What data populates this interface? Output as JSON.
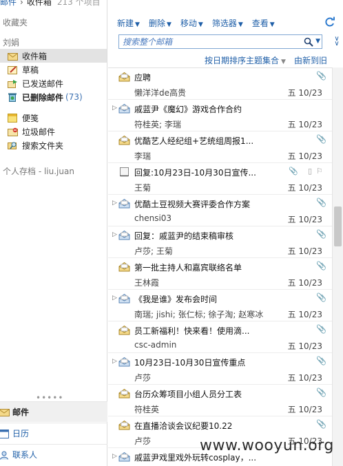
{
  "breadcrumb": {
    "root": "邮件",
    "current": "收件箱",
    "count": "213 个项目"
  },
  "leftnav": {
    "favorites_heading": "收藏夹",
    "account_heading": "刘娟",
    "folders": [
      {
        "label": "收件箱",
        "icon": "inbox-icon",
        "selected": true
      },
      {
        "label": "草稿",
        "icon": "drafts-icon"
      },
      {
        "label": "已发送邮件",
        "icon": "sent-icon"
      },
      {
        "label": "已删除邮件",
        "icon": "deleted-icon",
        "badge": "(73)",
        "bold": true
      },
      {
        "label": "便笺",
        "icon": "notes-icon"
      },
      {
        "label": "垃圾邮件",
        "icon": "junk-icon"
      },
      {
        "label": "搜索文件夹",
        "icon": "search-folder-icon"
      }
    ],
    "archive_heading": "个人存档 - liu.juan",
    "grip": "•••••",
    "bottom": [
      {
        "label": "邮件",
        "icon": "mail-icon",
        "active": true
      },
      {
        "label": "日历",
        "icon": "calendar-icon"
      },
      {
        "label": "联系人",
        "icon": "contacts-icon"
      }
    ]
  },
  "toolbar": {
    "new": "新建",
    "delete": "删除",
    "move": "移动",
    "filter": "筛选器",
    "view": "查看"
  },
  "search": {
    "placeholder": "搜索整个邮箱"
  },
  "sort": {
    "by": "按日期排序主题集合",
    "order": "由新到旧"
  },
  "messages": [
    {
      "subject": "应聘",
      "sender": "懒洋洋de高贵",
      "date": "五 10/23",
      "thread": false,
      "attach": true
    },
    {
      "subject": "戚蓝尹《魔幻》游戏合作合约",
      "sender": "符桂英; 李瑞",
      "date": "五 10/23",
      "thread": true,
      "attach": false
    },
    {
      "subject": "优酷艺人经纪组+艺统组周报1...",
      "sender": "李瑞",
      "date": "五 10/23",
      "thread": false,
      "attach": true
    },
    {
      "subject": "回复:10月23日-10月30日宣传...",
      "sender": "王菊",
      "date": "五 10/23",
      "thread": false,
      "attach": true,
      "draft": true
    },
    {
      "subject": "优酷土豆视频大赛评委合作方案",
      "sender": "chensi03",
      "date": "五 10/23",
      "thread": true,
      "attach": true
    },
    {
      "subject": "回复：戚蓝尹的结束稿审核",
      "sender": "卢莎; 王菊",
      "date": "五 10/23",
      "thread": true,
      "attach": true
    },
    {
      "subject": "第一批主持人和嘉宾联络名单",
      "sender": "王林霞",
      "date": "五 10/23",
      "thread": false,
      "attach": true
    },
    {
      "subject": "《我是谁》发布会时间",
      "sender": "南瑞; jishi; 张仁标; 徐子淘; 赵寒冰",
      "date": "五 10/23",
      "thread": true,
      "attach": true
    },
    {
      "subject": "员工新福利！快来看！使用滴...",
      "sender": "csc-admin",
      "date": "五 10/23",
      "thread": false,
      "attach": true
    },
    {
      "subject": "10月23日-10月30日宣传重点",
      "sender": "卢莎",
      "date": "五 10/23",
      "thread": true,
      "attach": true
    },
    {
      "subject": "台历众筹项目小组人员分工表",
      "sender": "符桂英",
      "date": "五 10/23",
      "thread": false,
      "attach": true
    },
    {
      "subject": "在直播洽谈会议纪要10.22",
      "sender": "卢莎",
      "date": "五 10/23",
      "thread": false,
      "attach": true
    },
    {
      "subject": "戚蓝尹戏里戏外玩转cosplay，...",
      "sender": "",
      "date": "",
      "thread": true,
      "attach": false
    }
  ],
  "watermark": "www.wooyun.org",
  "colors": {
    "link": "#1f5fa8",
    "selected_bg": "#e3e3e3",
    "envelope": "#e8c46a"
  }
}
